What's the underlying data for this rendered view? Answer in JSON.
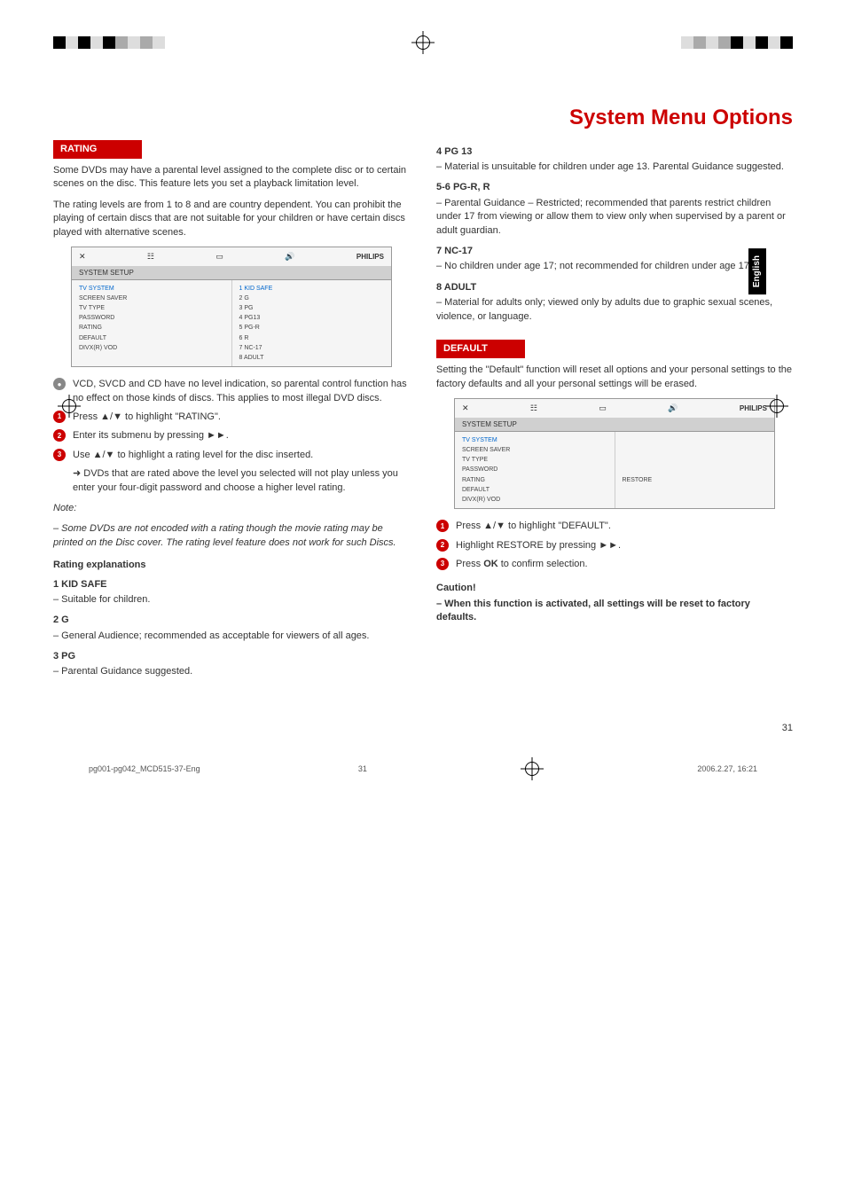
{
  "page_title": "System Menu Options",
  "lang_tab": "English",
  "left": {
    "rating_header": "RATING",
    "rating_p1": "Some DVDs may have a parental level assigned to the complete disc or to certain scenes on the disc. This feature lets you set a playback limitation level.",
    "rating_p2": "The rating levels are from 1 to 8 and are country dependent. You can prohibit the playing of certain discs that are not suitable for your children or have certain discs played with alternative scenes.",
    "menu1_tab": "SYSTEM SETUP",
    "menu1_brand": "PHILIPS",
    "menu1_left": [
      "TV SYSTEM",
      "SCREEN SAVER",
      "TV TYPE",
      "PASSWORD",
      "RATING",
      "DEFAULT",
      "DIVX(R) VOD"
    ],
    "menu1_right": [
      "1 KID SAFE",
      "2 G",
      "3 PG",
      "4 PG13",
      "5 PG-R",
      "6 R",
      "7 NC-17",
      "8 ADULT"
    ],
    "bullet_gray": "VCD, SVCD and CD have no level indication, so parental control function has no effect on those kinds of discs. This applies to most illegal DVD discs.",
    "step1": "Press ▲/▼ to highlight \"RATING\".",
    "step2": "Enter its submenu by pressing ►►.",
    "step3": "Use ▲/▼ to highlight a rating level for the disc inserted.",
    "step3_sub": "➜ DVDs that are rated above the level you selected will not play unless you enter your four-digit password and choose a higher level rating.",
    "note_label": "Note:",
    "note_body": "– Some DVDs are not encoded with a rating though the movie rating may be printed on the Disc cover. The rating level feature does not work for such Discs.",
    "expl_header": "Rating explanations",
    "l1_h": "1 KID SAFE",
    "l1_b": "– Suitable for children.",
    "l2_h": "2 G",
    "l2_b": "– General Audience; recommended as acceptable for viewers of all ages.",
    "l3_h": "3 PG",
    "l3_b": "– Parental Guidance suggested."
  },
  "right": {
    "l4_h": "4 PG 13",
    "l4_b": "– Material is unsuitable for children under age 13. Parental Guidance suggested.",
    "l5_h": "5-6 PG-R, R",
    "l5_b": "– Parental Guidance – Restricted; recommended that parents restrict children under 17 from viewing or allow them to view only when supervised by a parent or adult guardian.",
    "l7_h": "7 NC-17",
    "l7_b": "– No children under age 17; not recommended for children under age 17.",
    "l8_h": "8 ADULT",
    "l8_b": "– Material for adults only; viewed only by adults due to graphic sexual scenes, violence, or language.",
    "default_header": "DEFAULT",
    "default_p": "Setting the \"Default\" function will reset all options and your personal settings to the factory defaults and all your personal settings will be erased.",
    "menu2_tab": "SYSTEM SETUP",
    "menu2_brand": "PHILIPS",
    "menu2_left": [
      "TV SYSTEM",
      "SCREEN SAVER",
      "TV TYPE",
      "PASSWORD",
      "RATING",
      "DEFAULT",
      "DIVX(R) VOD"
    ],
    "menu2_right": "RESTORE",
    "dstep1": "Press ▲/▼ to highlight \"DEFAULT\".",
    "dstep2": "Highlight RESTORE by pressing ►►.",
    "dstep3_a": "Press ",
    "dstep3_b": "OK",
    "dstep3_c": " to confirm selection.",
    "caution_h": "Caution!",
    "caution_b": "– When this function is activated, all settings will be reset to factory defaults."
  },
  "page_num": "31",
  "footer_left": "pg001-pg042_MCD515-37-Eng",
  "footer_mid": "31",
  "footer_right": "2006.2.27, 16:21"
}
